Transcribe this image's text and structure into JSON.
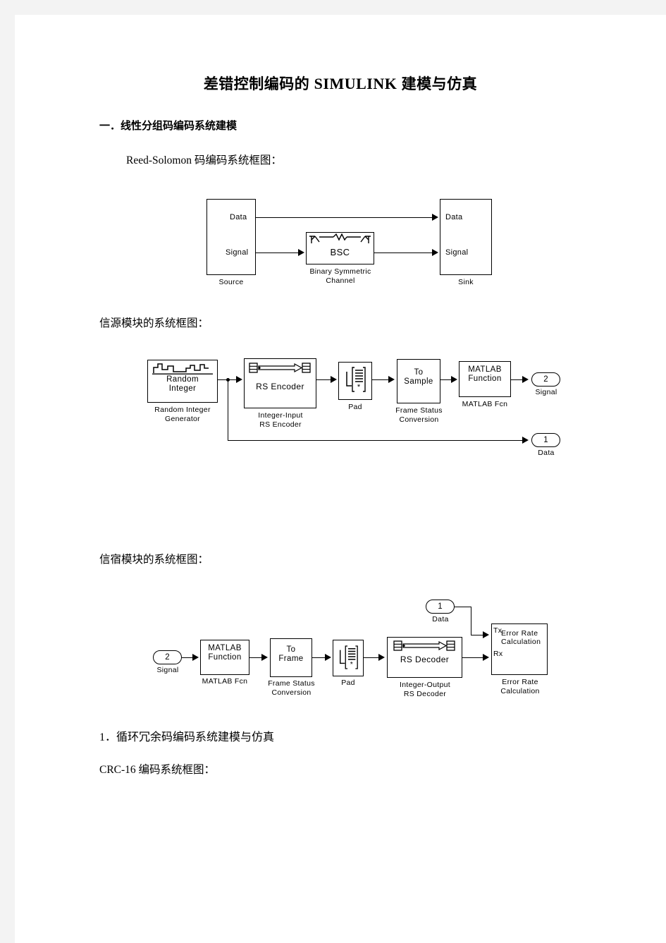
{
  "document": {
    "title_cn_1": "差错控制编码的 ",
    "title_latin": "SIMULINK",
    "title_cn_2": " 建模与仿真",
    "section_1_heading": "一．线性分组码编码系统建模",
    "caption_rs_framework": "Reed-Solomon 码编码系统框图：",
    "caption_source_module": "信源模块的系统框图：",
    "caption_sink_module": "信宿模块的系统框图：",
    "section_2_heading": "1．循环冗余码编码系统建模与仿真",
    "caption_crc_framework": "CRC-16 编码系统框图："
  },
  "figure_rs_system": {
    "blocks": [
      {
        "id": "source",
        "label": "",
        "caption": "Source",
        "ports": [
          "Data",
          "Signal"
        ]
      },
      {
        "id": "bsc",
        "label": "BSC",
        "caption": "Binary Symmetric\nChannel"
      },
      {
        "id": "sink",
        "label": "",
        "caption": "Sink",
        "ports": [
          "Data",
          "Signal"
        ]
      }
    ]
  },
  "figure_source_module": {
    "blocks": [
      {
        "id": "random-integer",
        "label": "Random\nInteger",
        "caption": "Random Integer\nGenerator"
      },
      {
        "id": "rs-encoder",
        "label": "RS Encoder",
        "caption": "Integer-Input\nRS Encoder"
      },
      {
        "id": "pad",
        "label": "",
        "caption": "Pad"
      },
      {
        "id": "to-sample",
        "label": "To\nSample",
        "caption": "Frame Status\nConversion"
      },
      {
        "id": "matlab-function",
        "label": "MATLAB\nFunction",
        "caption": "MATLAB Fcn"
      }
    ],
    "outports": [
      {
        "id": "signal",
        "number": "2",
        "caption": "Signal"
      },
      {
        "id": "data",
        "number": "1",
        "caption": "Data"
      }
    ]
  },
  "figure_sink_module": {
    "inports": [
      {
        "id": "signal",
        "number": "2",
        "caption": "Signal"
      },
      {
        "id": "data",
        "number": "1",
        "caption": "Data"
      }
    ],
    "blocks": [
      {
        "id": "matlab-function",
        "label": "MATLAB\nFunction",
        "caption": "MATLAB Fcn"
      },
      {
        "id": "to-frame",
        "label": "To\nFrame",
        "caption": "Frame Status\nConversion"
      },
      {
        "id": "pad",
        "label": "",
        "caption": "Pad"
      },
      {
        "id": "rs-decoder",
        "label": "RS Decoder",
        "caption": "Integer-Output\nRS Decoder"
      },
      {
        "id": "error-rate",
        "label": "Error Rate\nCalculation",
        "caption": "Error Rate\nCalculation",
        "ports": [
          "Tx",
          "Rx"
        ]
      }
    ]
  }
}
